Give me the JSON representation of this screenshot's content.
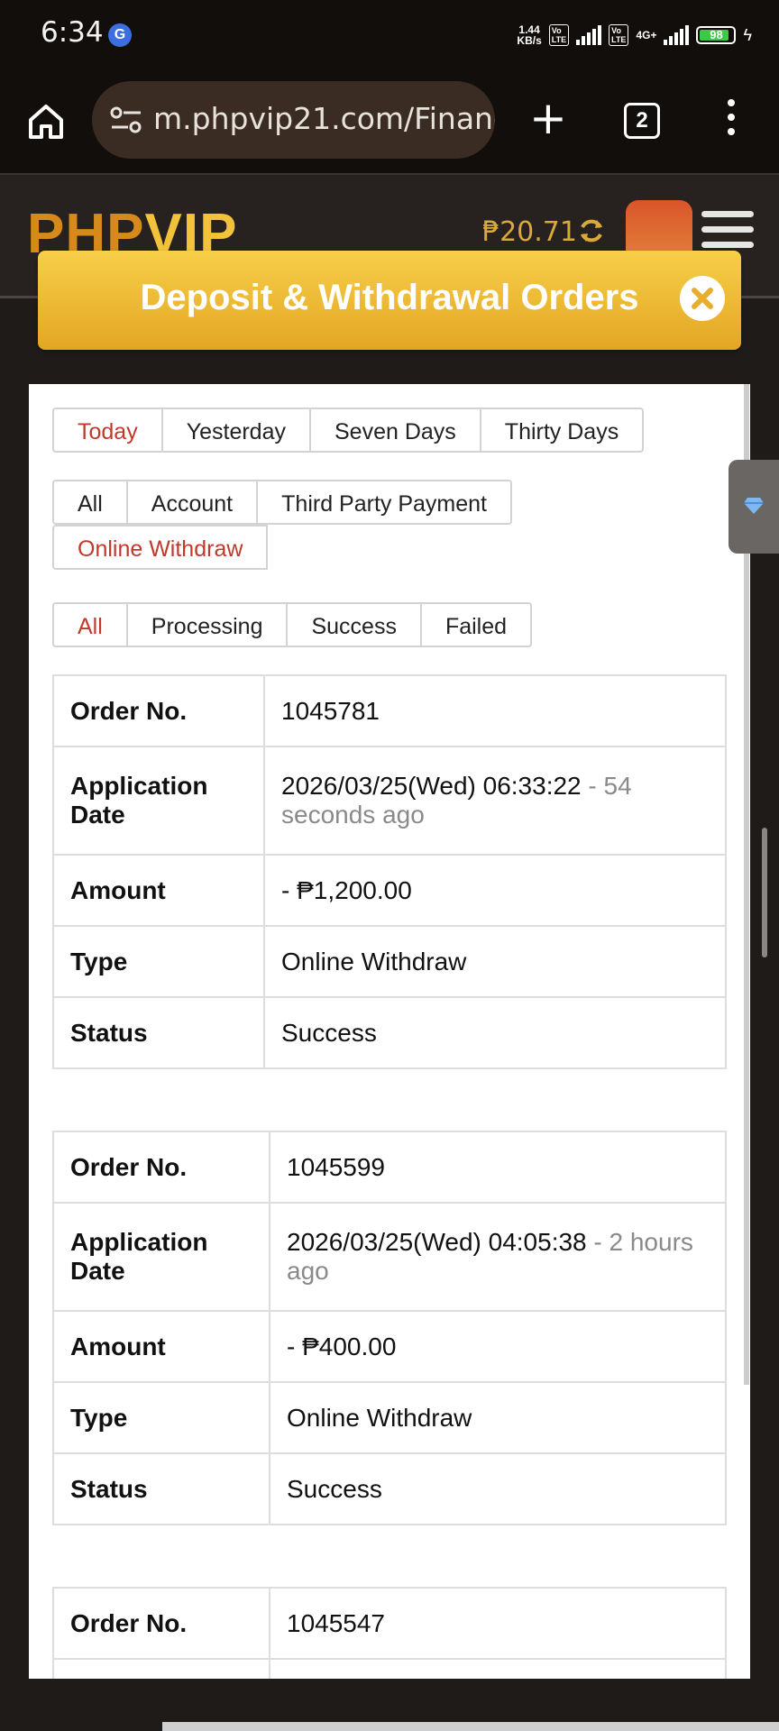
{
  "status_bar": {
    "time": "6:34",
    "speed_top": "1.44",
    "speed_bottom": "KB/s",
    "volte": "Vo LTE",
    "network": "4G+",
    "battery": "98"
  },
  "browser": {
    "url": "m.phpvip21.com/Finance",
    "tab_count": "2"
  },
  "site": {
    "logo_part1": "PHP",
    "logo_part2": "VIP",
    "balance": "₱20.71"
  },
  "modal": {
    "title": "Deposit & Withdrawal Orders"
  },
  "filters": {
    "period": [
      "Today",
      "Yesterday",
      "Seven Days",
      "Thirty Days"
    ],
    "period_active": "Today",
    "category": [
      "All",
      "Account",
      "Third Party Payment",
      "Online Withdraw"
    ],
    "category_active": "Online Withdraw",
    "status": [
      "All",
      "Processing",
      "Success",
      "Failed"
    ],
    "status_active": "All"
  },
  "labels": {
    "order_no": "Order No.",
    "application_date": "Application Date",
    "amount": "Amount",
    "type": "Type",
    "status": "Status"
  },
  "orders": [
    {
      "order_no": "1045781",
      "date": "2026/03/25(Wed) 06:33:22",
      "ago": " - 54 seconds ago",
      "amount": "- ₱1,200.00",
      "type": "Online Withdraw",
      "status": "Success"
    },
    {
      "order_no": "1045599",
      "date": "2026/03/25(Wed) 04:05:38",
      "ago": " - 2 hours ago",
      "amount": "- ₱400.00",
      "type": "Online Withdraw",
      "status": "Success"
    },
    {
      "order_no": "1045547"
    }
  ]
}
